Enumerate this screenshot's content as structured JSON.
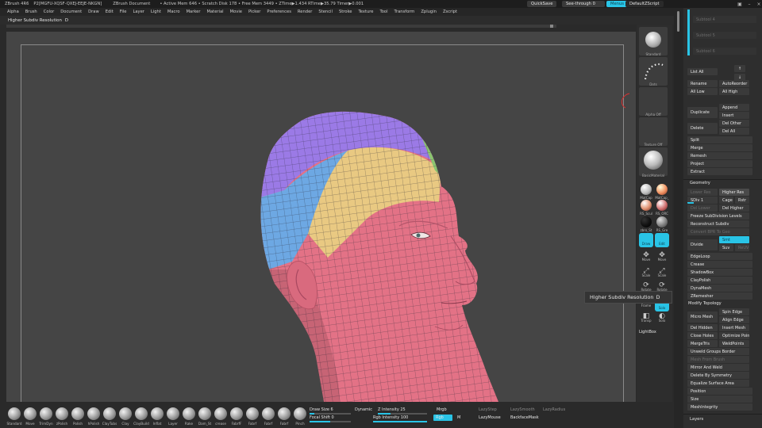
{
  "titlebar": {
    "app": "ZBrush 4R6",
    "version": "P2[MGFU-XQSF-QXEJ-EEJE-NKGN]",
    "document": "ZBrush Document",
    "stats": "• Active Mem 646 • Scratch Disk 178 • Free Mem 3449 • ZTime▶1.434 RTime▶35.79 Timer▶0.001",
    "quicksave": "QuickSave",
    "seethrough": "See-through 0",
    "menus": "Menus",
    "script": "DefaultZScript",
    "win_controls": [
      "▣",
      "–",
      "×"
    ]
  },
  "menubar": {
    "items": [
      "Alpha",
      "Brush",
      "Color",
      "Document",
      "Draw",
      "Edit",
      "File",
      "Layer",
      "Light",
      "Macro",
      "Marker",
      "Material",
      "Movie",
      "Picker",
      "Preferences",
      "Render",
      "Stencil",
      "Stroke",
      "Texture",
      "Tool",
      "Transform",
      "Zplugin",
      "Zscript"
    ]
  },
  "infobar": {
    "label": "Higher Subdiv Resolution",
    "shortcut": "D"
  },
  "tooltip": {
    "text": "Higher Subdiv Resolution",
    "shortcut": "D"
  },
  "shelf": {
    "slots": [
      "Standard",
      "Dots",
      "Alpha Off",
      "Texture Off",
      "BasicMaterial"
    ],
    "materials": [
      "MatCap",
      "MatCap_",
      "RS_Scul",
      "RS_ORC",
      "zbro_St",
      "RS_Gre"
    ],
    "tools": [
      "Draw",
      "Edit",
      "Move",
      "Move",
      "Scale",
      "Scale",
      "Rotate",
      "Rotate",
      "Frame",
      "Solo",
      "Transp",
      "Solo"
    ],
    "lightbox": "LightBox"
  },
  "palette": {
    "subtools": [
      "Subtool 4",
      "Subtool 5",
      "Subtool 6"
    ],
    "list_all": "List All",
    "arrows": [
      "↑",
      "↓"
    ],
    "rename": "Rename",
    "autoreorder": "AutoReorder",
    "all_low": "All Low",
    "all_high": "All High",
    "duplicate": "Duplicate",
    "append": "Append",
    "insert": "Insert",
    "delete": "Delete",
    "del_other": "Del Other",
    "del_all": "Del All",
    "split": "Split",
    "merge": "Merge",
    "remesh": "Remesh",
    "project": "Project",
    "extract": "Extract",
    "geometry": "Geometry",
    "lower_res": "Lower Res",
    "higher_res": "Higher Res",
    "sdiv": "SDiv 1",
    "cage": "Cage",
    "rstr": "Rstr",
    "del_lower": "Del Lower",
    "del_higher": "Del Higher",
    "freeze_subdiv": "Freeze SubDivision Levels",
    "reconstruct": "Reconstruct Subdiv",
    "convert_bpr": "Convert BPR To Geo",
    "divide": "Divide",
    "smt": "Smt",
    "suv": "Suv",
    "reuv": "ReUV",
    "edgeloop": "EdgeLoop",
    "crease": "Crease",
    "shadowbox": "ShadowBox",
    "claypolish": "ClayPolish",
    "dynamesh": "DynaMesh",
    "zremesher": "ZRemesher",
    "modify_topology": "Modify Topology",
    "spin_edge": "Spin Edge",
    "align_edge": "Align Edge",
    "micro_mesh": "Micro Mesh",
    "del_hidden": "Del Hidden",
    "insert_mesh": "Insert Mesh",
    "close_holes": "Close Holes",
    "optimize_points": "Optimize Points",
    "mergetris": "MergeTris",
    "weldpoints": "WeldPoints",
    "unweld_groups": "Unweld Groups Border",
    "mesh_from_brush": "Mesh From Brush",
    "mirror_weld": "Mirror And Weld",
    "delete_symmetry": "Delete By Symmetry",
    "equalize": "Equalize Surface Area",
    "position": "Position",
    "size": "Size",
    "meshintegrity": "MeshIntegrity",
    "layers": "Layers"
  },
  "bottom": {
    "brushes": [
      "Standard",
      "Move",
      "TrimDyn",
      "zPolish",
      "Polish",
      "hPolish",
      "ClayTubs",
      "Clay",
      "ClayBuild",
      "Inflat",
      "Layer",
      "Rake",
      "Dam_St",
      "crease",
      "FabrfF",
      "Fabrf",
      "Fabrf",
      "Fabrf",
      "Pinch"
    ],
    "draw_size": "Draw Size 6",
    "dynamic": "Dynamic",
    "z_intensity": "Z Intensity 25",
    "focal_shift": "Focal Shift 0",
    "rgb_intensity": "Rgb Intensity 100",
    "mrgb": "Mrgb",
    "rgb": "Rgb",
    "m": "M",
    "lazystep": "LazyStep",
    "lazysmooth": "LazySmooth",
    "lazyradius": "LazyRadius",
    "lazymouse": "LazyMouse",
    "backfacemask": "BackfaceMask"
  },
  "colors": {
    "accent": "#29c4e6",
    "bg": "#454545",
    "skin": "#e07080",
    "purple": "#9b7ae0",
    "blue": "#6aa5e0",
    "yellow": "#e8c87a",
    "green": "#88c070"
  }
}
